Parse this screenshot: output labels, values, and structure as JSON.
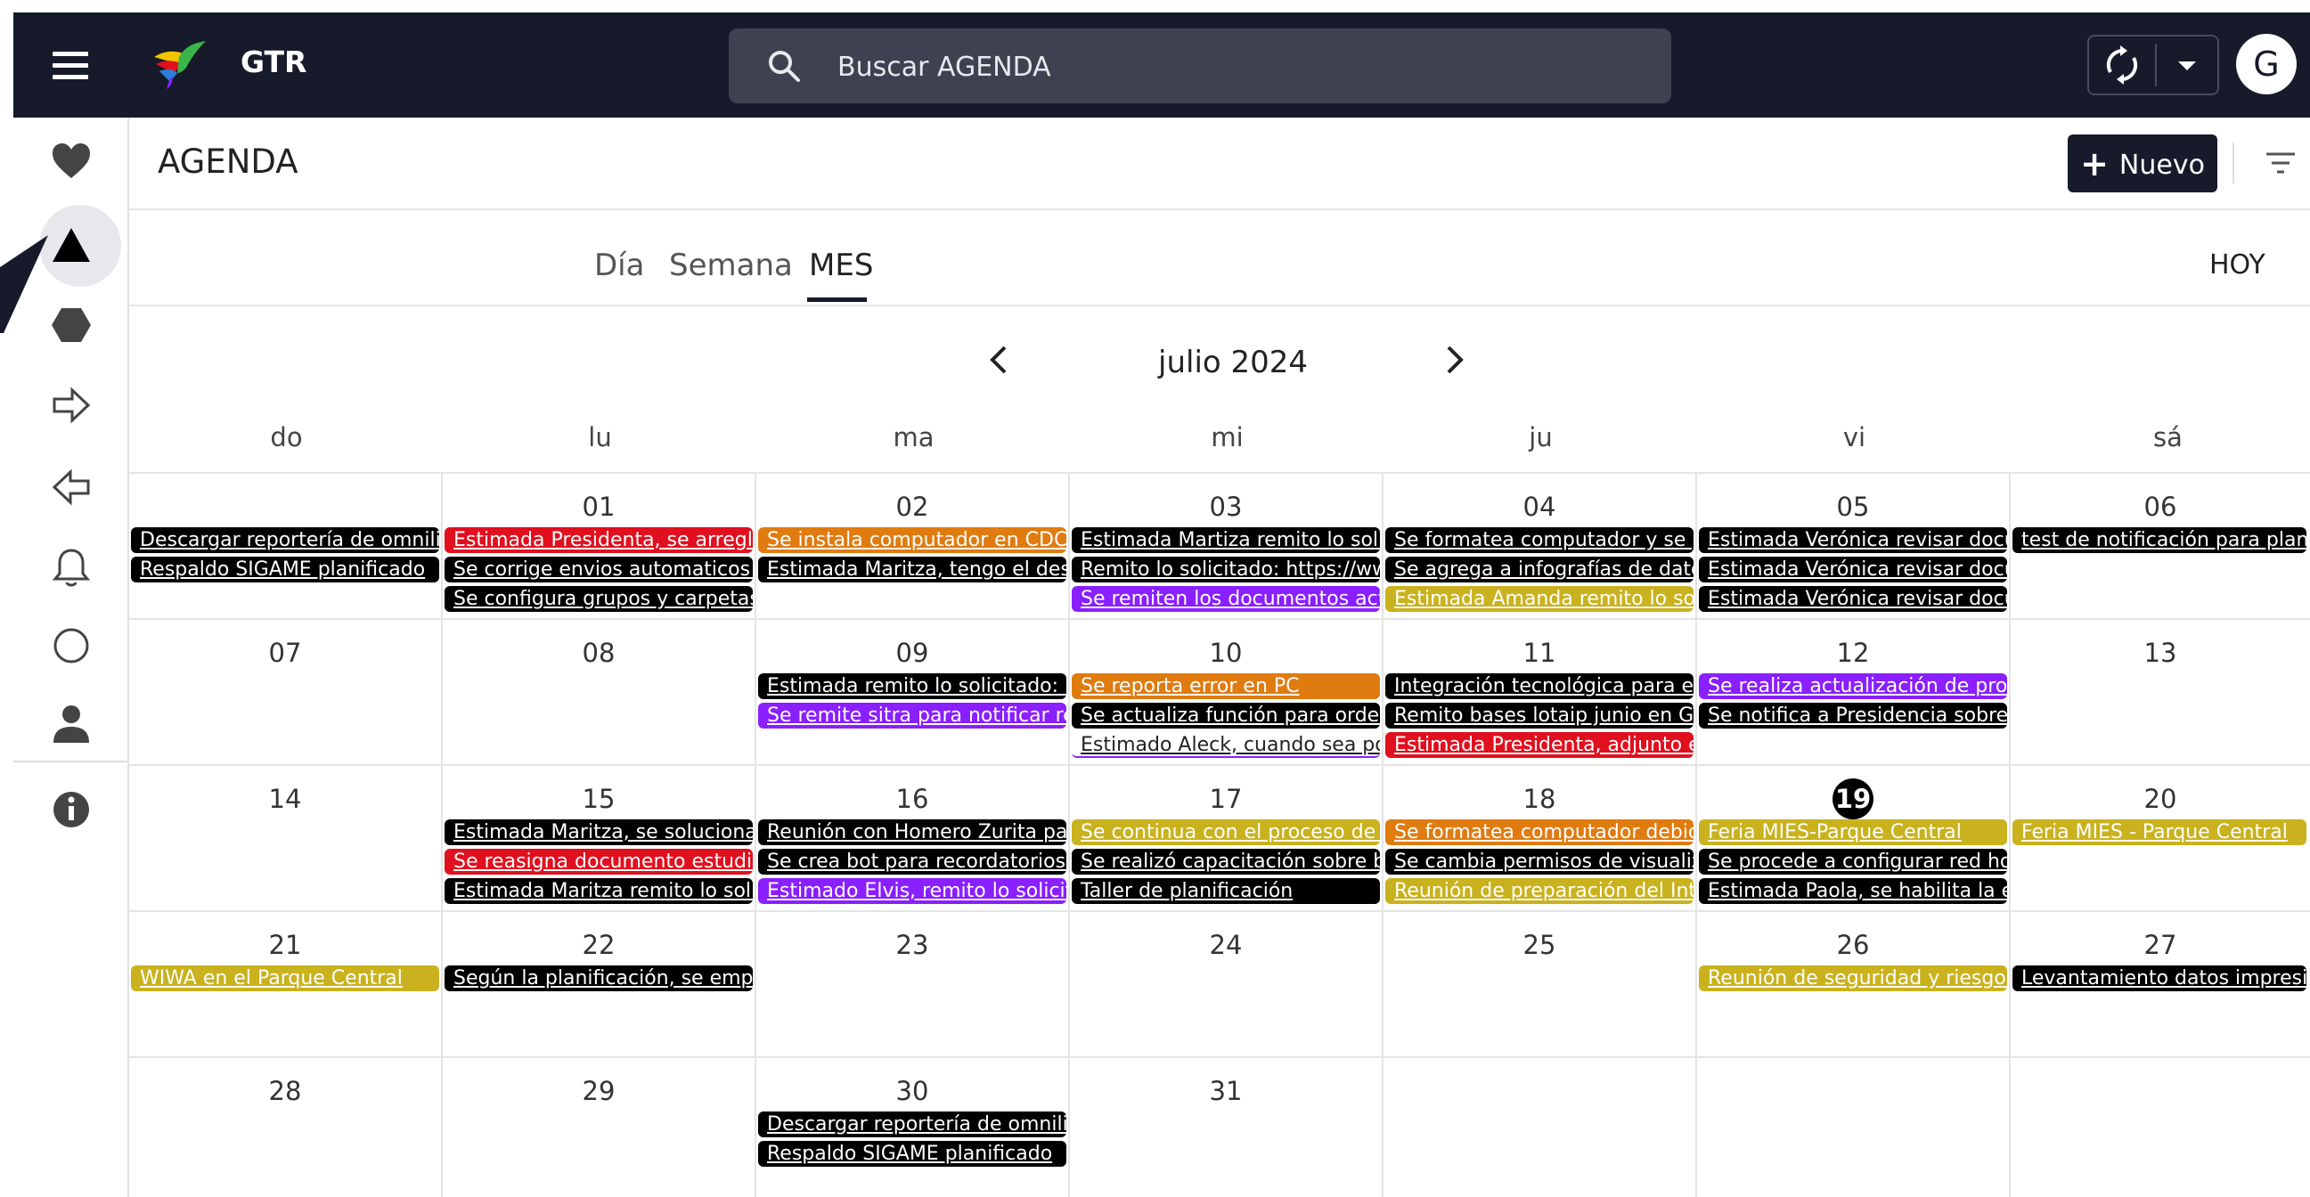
{
  "app": {
    "name": "GTR"
  },
  "search": {
    "placeholder": "Buscar AGENDA"
  },
  "avatar": {
    "initial": "G"
  },
  "page": {
    "title": "AGENDA",
    "new_label": "Nuevo",
    "today_label": "HOY"
  },
  "tabs": [
    {
      "label": "Día"
    },
    {
      "label": "Semana"
    },
    {
      "label": "MES"
    }
  ],
  "calendar": {
    "month_label": "julio 2024",
    "weekdays": [
      "do",
      "lu",
      "ma",
      "mi",
      "ju",
      "vi",
      "sá"
    ],
    "today": "19",
    "weeks": [
      [
        {
          "day": "",
          "events": [
            {
              "text": "Descargar reportería de omnilink",
              "color": "#000000"
            },
            {
              "text": "Respaldo SIGAME planificado",
              "color": "#000000"
            }
          ]
        },
        {
          "day": "01",
          "events": [
            {
              "text": "Estimada Presidenta, se arreglan",
              "color": "#e0101f"
            },
            {
              "text": "Se corrige envios automaticos inf",
              "color": "#000000"
            },
            {
              "text": "Se configura grupos y carpetas c",
              "color": "#000000"
            }
          ]
        },
        {
          "day": "02",
          "events": [
            {
              "text": "Se instala computador en CDC, ju",
              "color": "#e07b10"
            },
            {
              "text": "Estimada Maritza, tengo el desag",
              "color": "#000000"
            }
          ]
        },
        {
          "day": "03",
          "events": [
            {
              "text": "Estimada Martiza remito lo solici",
              "color": "#000000"
            },
            {
              "text": "Remito lo solicitado: https://www",
              "color": "#000000"
            },
            {
              "text": "Se remiten los documentos actua",
              "color": "#8a1fff"
            }
          ]
        },
        {
          "day": "04",
          "events": [
            {
              "text": "Se formatea computador y se po",
              "color": "#000000"
            },
            {
              "text": "Se agrega a infografías de datos :",
              "color": "#000000"
            },
            {
              "text": "Estimada Amanda remito lo solic",
              "color": "#c9b21e"
            }
          ]
        },
        {
          "day": "05",
          "events": [
            {
              "text": "Estimada Verónica revisar docum",
              "color": "#000000"
            },
            {
              "text": "Estimada Verónica revisar docum",
              "color": "#000000"
            },
            {
              "text": "Estimada Verónica revisar docum",
              "color": "#000000"
            }
          ]
        },
        {
          "day": "06",
          "events": [
            {
              "text": "test de notificación para planific",
              "color": "#000000"
            }
          ]
        }
      ],
      [
        {
          "day": "07",
          "events": []
        },
        {
          "day": "08",
          "events": []
        },
        {
          "day": "09",
          "events": [
            {
              "text": "Estimada remito lo solicitado: htt",
              "color": "#000000"
            },
            {
              "text": "Se remite sitra para notificar rep",
              "color": "#8a1fff"
            }
          ]
        },
        {
          "day": "10",
          "events": [
            {
              "text": "Se reporta error en PC",
              "color": "#e07b10"
            },
            {
              "text": "Se actualiza función para ordene",
              "color": "#000000"
            },
            {
              "text": "Estimado Aleck, cuando sea posil",
              "color": "#ffffff"
            }
          ]
        },
        {
          "day": "11",
          "events": [
            {
              "text": "Integración tecnológica para edu",
              "color": "#000000"
            },
            {
              "text": "Remito bases lotaip junio en GTR",
              "color": "#000000"
            },
            {
              "text": "Estimada Presidenta, adjunto en",
              "color": "#e0101f"
            }
          ]
        },
        {
          "day": "12",
          "events": [
            {
              "text": "Se realiza actualización de progra",
              "color": "#8a1fff"
            },
            {
              "text": "Se notifica a Presidencia sobre in",
              "color": "#000000"
            }
          ]
        },
        {
          "day": "13",
          "events": []
        }
      ],
      [
        {
          "day": "14",
          "events": []
        },
        {
          "day": "15",
          "events": [
            {
              "text": "Estimada Maritza, se soluciona p",
              "color": "#000000"
            },
            {
              "text": "Se reasigna documento estudio c",
              "color": "#e0101f"
            },
            {
              "text": "Estimada Maritza remito lo solici",
              "color": "#000000"
            }
          ]
        },
        {
          "day": "16",
          "events": [
            {
              "text": "Reunión con Homero Zurita para",
              "color": "#000000"
            },
            {
              "text": "Se crea bot para recordatorios de",
              "color": "#000000"
            },
            {
              "text": "Estimado Elvis, remito lo solicitac",
              "color": "#8a1fff"
            }
          ]
        },
        {
          "day": "17",
          "events": [
            {
              "text": "Se continua con el proceso de mi",
              "color": "#c9b21e"
            },
            {
              "text": "Se realizó capacitación sobre bib",
              "color": "#000000"
            },
            {
              "text": "Taller de planificación",
              "color": "#000000"
            }
          ]
        },
        {
          "day": "18",
          "events": [
            {
              "text": "Se formatea computador debido",
              "color": "#e07b10"
            },
            {
              "text": "Se cambia permisos de visualizac",
              "color": "#000000"
            },
            {
              "text": "Reunión de preparación del Inter",
              "color": "#c9b21e"
            }
          ]
        },
        {
          "day": "19",
          "events": [
            {
              "text": "Feria MIES-Parque Central",
              "color": "#c9b21e"
            },
            {
              "text": "Se procede a configurar red hosp",
              "color": "#000000"
            },
            {
              "text": "Estimada Paola, se habilita la enc",
              "color": "#000000"
            }
          ]
        },
        {
          "day": "20",
          "events": [
            {
              "text": "Feria MIES - Parque Central",
              "color": "#c9b21e"
            }
          ]
        }
      ],
      [
        {
          "day": "21",
          "events": [
            {
              "text": "WIWA en el Parque Central",
              "color": "#c9b21e"
            }
          ]
        },
        {
          "day": "22",
          "events": [
            {
              "text": "Según la planificación, se empiez",
              "color": "#000000"
            }
          ]
        },
        {
          "day": "23",
          "events": []
        },
        {
          "day": "24",
          "events": []
        },
        {
          "day": "25",
          "events": []
        },
        {
          "day": "26",
          "events": [
            {
              "text": "Reunión de seguridad y riesgos s",
              "color": "#c9b21e"
            }
          ]
        },
        {
          "day": "27",
          "events": [
            {
              "text": "Levantamiento datos impresion",
              "color": "#000000"
            }
          ]
        }
      ],
      [
        {
          "day": "28",
          "events": []
        },
        {
          "day": "29",
          "events": []
        },
        {
          "day": "30",
          "events": [
            {
              "text": "Descargar reportería de omnilink",
              "color": "#000000"
            },
            {
              "text": "Respaldo SIGAME planificado",
              "color": "#000000"
            }
          ]
        },
        {
          "day": "31",
          "events": []
        },
        {
          "day": "",
          "events": []
        },
        {
          "day": "",
          "events": []
        },
        {
          "day": "",
          "events": []
        }
      ]
    ]
  }
}
